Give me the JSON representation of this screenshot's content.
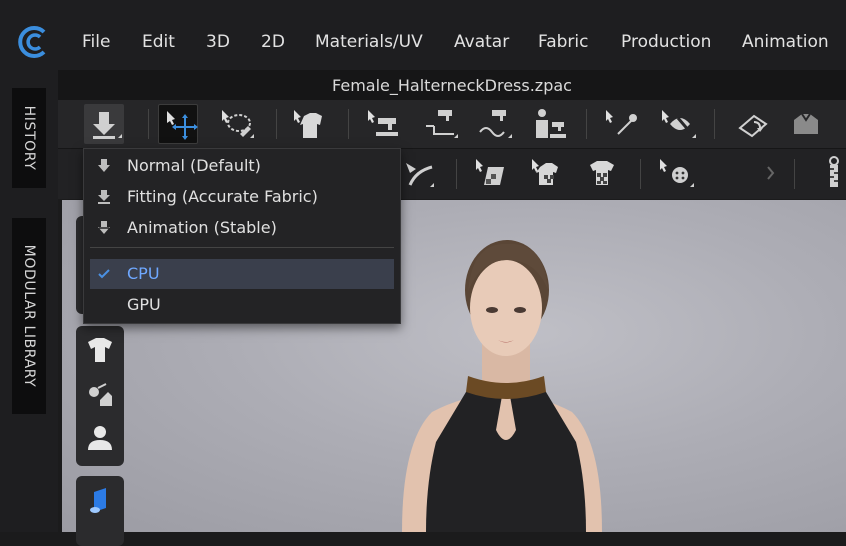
{
  "app": {
    "menu": [
      "File",
      "Edit",
      "3D",
      "2D",
      "Materials/UV",
      "Avatar",
      "Fabric",
      "Production",
      "Animation"
    ],
    "file_title": "Female_HalterneckDress.zpac"
  },
  "left_tabs": {
    "history": "HISTORY",
    "modular_library": "MODULAR LIBRARY"
  },
  "simulation_menu": {
    "modes": [
      {
        "label": "Normal (Default)",
        "icon": "simulation-normal-icon"
      },
      {
        "label": "Fitting (Accurate Fabric)",
        "icon": "simulation-fitting-icon"
      },
      {
        "label": "Animation (Stable)",
        "icon": "simulation-animation-icon"
      }
    ],
    "devices": [
      {
        "label": "CPU",
        "checked": true
      },
      {
        "label": "GPU",
        "checked": false
      }
    ]
  },
  "colors": {
    "accent": "#3b8ede",
    "selected_bg": "#3a3f4c",
    "menubar_bg": "#1e1e20"
  }
}
